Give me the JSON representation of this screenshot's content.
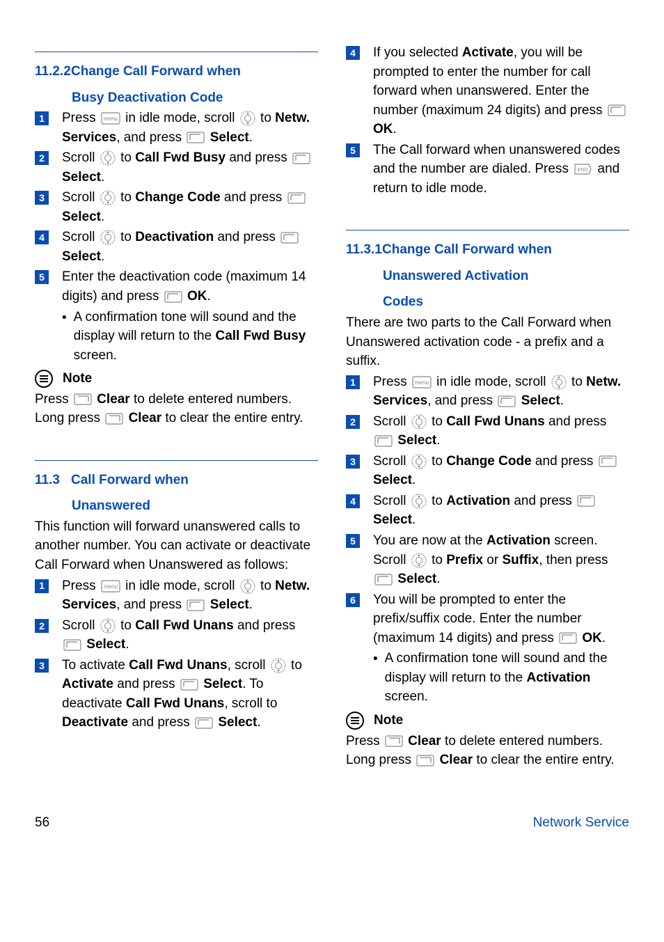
{
  "left": {
    "sec1122": {
      "num": "11.2.2",
      "title_l1": "Change Call Forward when",
      "title_l2": "Busy Deactivation Code",
      "steps": [
        {
          "n": "1",
          "parts": [
            "Press ",
            "ICON_MENU",
            " in idle mode, scroll ",
            "ICON_NAV",
            " to ",
            "<b>Netw. Services</b>",
            ", and press ",
            "ICON_SOFT",
            " ",
            "<b>Select</b>",
            "."
          ]
        },
        {
          "n": "2",
          "parts": [
            "Scroll ",
            "ICON_NAV",
            " to ",
            "<b>Call Fwd Busy</b>",
            " and press ",
            "ICON_SOFT",
            " ",
            "<b>Select</b>",
            "."
          ]
        },
        {
          "n": "3",
          "parts": [
            "Scroll ",
            "ICON_NAV",
            " to ",
            "<b>Change Code</b>",
            " and press ",
            "ICON_SOFT",
            " ",
            "<b>Select</b>",
            "."
          ]
        },
        {
          "n": "4",
          "parts": [
            "Scroll ",
            "ICON_NAV",
            " to ",
            "<b>Deactivation</b>",
            " and press ",
            "ICON_SOFT",
            " ",
            "<b>Select</b>",
            "."
          ]
        },
        {
          "n": "5",
          "parts": [
            "Enter the deactivation code (maximum 14 digits) and press ",
            "ICON_SOFT",
            " ",
            "<b>OK</b>",
            "."
          ]
        }
      ],
      "sub": [
        "A confirmation tone will sound and the display will return to the ",
        "<b>Call Fwd Busy</b>",
        " screen."
      ]
    },
    "note1": {
      "label": "Note",
      "body": [
        "Press ",
        "ICON_SOFTR",
        " ",
        "<b>Clear</b>",
        " to delete entered numbers. Long press ",
        "ICON_SOFTR",
        " ",
        "<b>Clear</b>",
        " to clear the entire entry."
      ]
    },
    "sec113": {
      "num": "11.3",
      "title_l1": "Call Forward when",
      "title_l2": "Unanswered",
      "intro": "This function will forward unanswered calls to another number. You can activate or deactivate Call Forward when Unanswered as follows:",
      "steps": [
        {
          "n": "1",
          "parts": [
            "Press ",
            "ICON_MENU",
            " in idle mode, scroll ",
            "ICON_NAV",
            " to ",
            "<b>Netw. Services</b>",
            ", and press ",
            "ICON_SOFT",
            " ",
            "<b>Select</b>",
            "."
          ]
        },
        {
          "n": "2",
          "parts": [
            "Scroll ",
            "ICON_NAV",
            " to ",
            "<b>Call Fwd Unans</b>",
            " and press ",
            "ICON_SOFT",
            " ",
            "<b>Select</b>",
            "."
          ]
        },
        {
          "n": "3",
          "parts": [
            "To activate ",
            "<b>Call Fwd Unans</b>",
            ", scroll ",
            "ICON_NAV",
            " to ",
            "<b>Activate</b>",
            " and press ",
            "ICON_SOFT",
            " ",
            "<b>Select</b>",
            ". To deactivate ",
            "<b>Call Fwd Unans</b>",
            ", scroll to ",
            "<b>Deactivate</b>",
            " and press ",
            "ICON_SOFT",
            " ",
            "<b>Select</b>",
            "."
          ]
        }
      ]
    }
  },
  "right": {
    "cont_steps": [
      {
        "n": "4",
        "parts": [
          "If you selected ",
          "<b>Activate</b>",
          ", you will be prompted to enter the number for call forward when unanswered. Enter the number (maximum 24 digits) and press ",
          "ICON_SOFT",
          " ",
          "<b>OK</b>",
          "."
        ]
      },
      {
        "n": "5",
        "parts": [
          "The Call forward when unanswered codes and the number are dialed. Press ",
          "ICON_END",
          " and return to idle mode."
        ]
      }
    ],
    "sec1131": {
      "num": "11.3.1",
      "title_l1": "Change Call Forward when",
      "title_l2": "Unanswered Activation",
      "title_l3": "Codes",
      "intro": "There are two parts to the Call Forward when Unanswered activation code - a prefix and a suffix.",
      "steps": [
        {
          "n": "1",
          "parts": [
            "Press ",
            "ICON_MENU",
            " in idle mode, scroll ",
            "ICON_NAV",
            " to ",
            "<b>Netw. Services</b>",
            ", and press ",
            "ICON_SOFT",
            " ",
            "<b>Select</b>",
            "."
          ]
        },
        {
          "n": "2",
          "parts": [
            "Scroll ",
            "ICON_NAV",
            " to ",
            "<b>Call Fwd Unans</b>",
            " and press ",
            "ICON_SOFT",
            " ",
            "<b>Select</b>",
            "."
          ]
        },
        {
          "n": "3",
          "parts": [
            "Scroll ",
            "ICON_NAV",
            " to ",
            "<b>Change Code</b>",
            " and press ",
            "ICON_SOFT",
            " ",
            "<b>Select</b>",
            "."
          ]
        },
        {
          "n": "4",
          "parts": [
            "Scroll ",
            "ICON_NAV",
            " to ",
            "<b>Activation</b>",
            " and press ",
            "ICON_SOFT",
            " ",
            "<b>Select</b>",
            "."
          ]
        },
        {
          "n": "5",
          "parts": [
            "You are now at the ",
            "<b>Activation</b>",
            " screen. Scroll ",
            "ICON_NAV",
            " to ",
            "<b>Prefix</b>",
            " or ",
            "<b>Suffix</b>",
            ", then press ",
            "ICON_SOFT",
            " ",
            "<b>Select</b>",
            "."
          ]
        },
        {
          "n": "6",
          "parts": [
            "You will be prompted to enter the prefix/suffix code. Enter the number (maximum 14 digits) and press ",
            "ICON_SOFT",
            " ",
            "<b>OK</b>",
            "."
          ]
        }
      ],
      "sub": [
        "A confirmation tone will sound and the display will return to the ",
        "<b>Activation</b>",
        " screen."
      ]
    },
    "note2": {
      "label": "Note",
      "body": [
        "Press ",
        "ICON_SOFTR",
        " ",
        "<b>Clear</b>",
        " to delete entered numbers. Long press ",
        "ICON_SOFTR",
        " ",
        "<b>Clear</b>",
        " to clear the entire entry."
      ]
    }
  },
  "footer": {
    "page": "56",
    "label": "Network Service"
  }
}
